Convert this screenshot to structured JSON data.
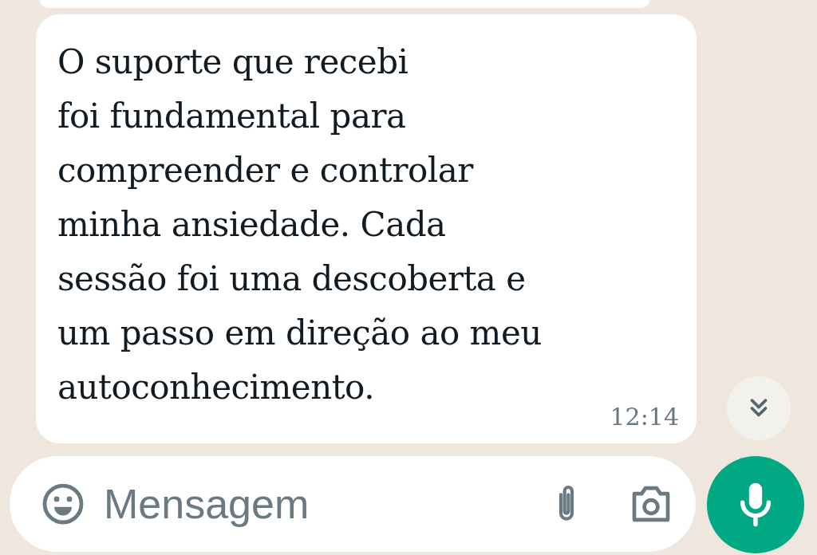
{
  "message": {
    "text": "O suporte que recebi\nfoi fundamental para\ncompreender e controlar\nminha ansiedade. Cada\nsessão foi uma descoberta e\num passo em direção ao meu\nautoconhecimento.",
    "time": "12:14"
  },
  "composer": {
    "placeholder": "Mensagem"
  }
}
